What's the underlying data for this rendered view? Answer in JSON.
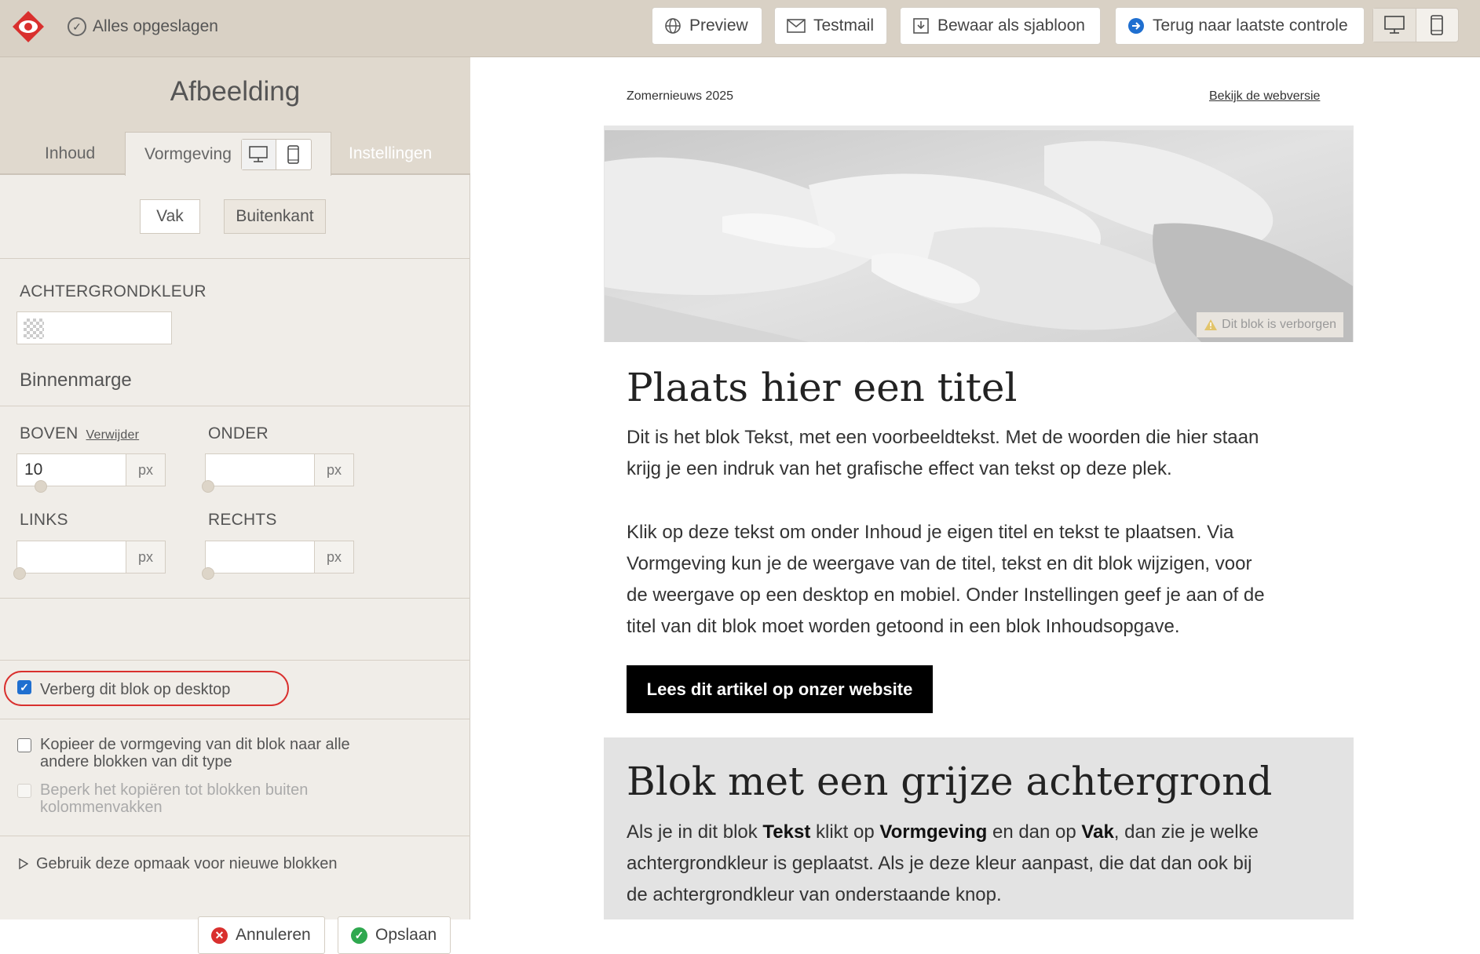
{
  "topbar": {
    "saved_label": "Alles opgeslagen",
    "preview_label": "Preview",
    "testmail_label": "Testmail",
    "template_label": "Bewaar als sjabloon",
    "back_label": "Terug naar laatste controle"
  },
  "panel": {
    "title": "Afbeelding",
    "tabs": {
      "content": "Inhoud",
      "design": "Vormgeving",
      "settings": "Instellingen"
    },
    "segments": {
      "box": "Vak",
      "outside": "Buitenkant"
    },
    "bgcolor_label": "ACHTERGRONDKLEUR",
    "padding_title": "Binnenmarge",
    "top_label": "BOVEN",
    "remove_label": "Verwijder",
    "bottom_label": "ONDER",
    "left_label": "LINKS",
    "right_label": "RECHTS",
    "unit": "px",
    "top_value": "10",
    "bottom_value": "",
    "left_value": "",
    "right_value": "",
    "hide_desktop_label": "Verberg dit blok op desktop",
    "hide_desktop_checked": true,
    "copy_label_1": "Kopieer de vormgeving van dit blok naar alle",
    "copy_label_2": "andere blokken van dit type",
    "limit_label_1": "Beperk het kopiëren tot blokken buiten",
    "limit_label_2": "kolommenvakken",
    "use_for_new_label": "Gebruik deze opmaak voor nieuwe blokken",
    "cancel_label": "Annuleren",
    "save_label": "Opslaan"
  },
  "email": {
    "header_left": "Zomernieuws 2025",
    "header_right": "Bekijk de webversie",
    "hidden_badge": "Dit blok is verborgen",
    "title": "Plaats hier een titel",
    "para1_line1": "Dit is het blok Tekst, met een voorbeeldtekst. Met de woorden die hier staan",
    "para1_line2": "krijg je een indruk van het grafische effect van tekst op deze plek.",
    "para2_line1": "Klik op deze tekst om onder Inhoud je eigen titel en tekst te plaatsen. Via",
    "para2_line2": "Vormgeving kun je de weergave van de titel, tekst en dit blok wijzigen, voor",
    "para2_line3": "de weergave op een desktop en mobiel. Onder Instellingen geef je aan of de",
    "para2_line4": "titel van dit blok moet worden getoond in een blok Inhoudsopgave.",
    "cta": "Lees dit artikel op onzer website",
    "gray_title": "Blok met een grijze achtergrond",
    "gray_p_1a": "Als je in dit blok ",
    "gray_p_1b": "Tekst",
    "gray_p_1c": " klikt op ",
    "gray_p_1d": "Vormgeving",
    "gray_p_1e": " en dan op ",
    "gray_p_1f": "Vak",
    "gray_p_1g": ", dan zie je welke",
    "gray_p_2": "achtergrondkleur is geplaatst. Als je deze kleur aanpast, die dat dan ook bij",
    "gray_p_3": "de achtergrondkleur van onderstaande knop."
  },
  "colors": {
    "brand_red": "#d9302e",
    "panel_bg": "#f0ede8",
    "topbar_bg": "#d9d1c5",
    "preview_blue": "#1f6fd0",
    "save_green": "#2fa84f"
  },
  "icons": [
    "logo-icon",
    "check-circle-icon",
    "globe-icon",
    "mail-icon",
    "save-template-icon",
    "arrow-right-circle-icon",
    "desktop-icon",
    "mobile-icon",
    "warning-icon",
    "close-circle-icon",
    "check-icon",
    "triangle-right-icon"
  ]
}
